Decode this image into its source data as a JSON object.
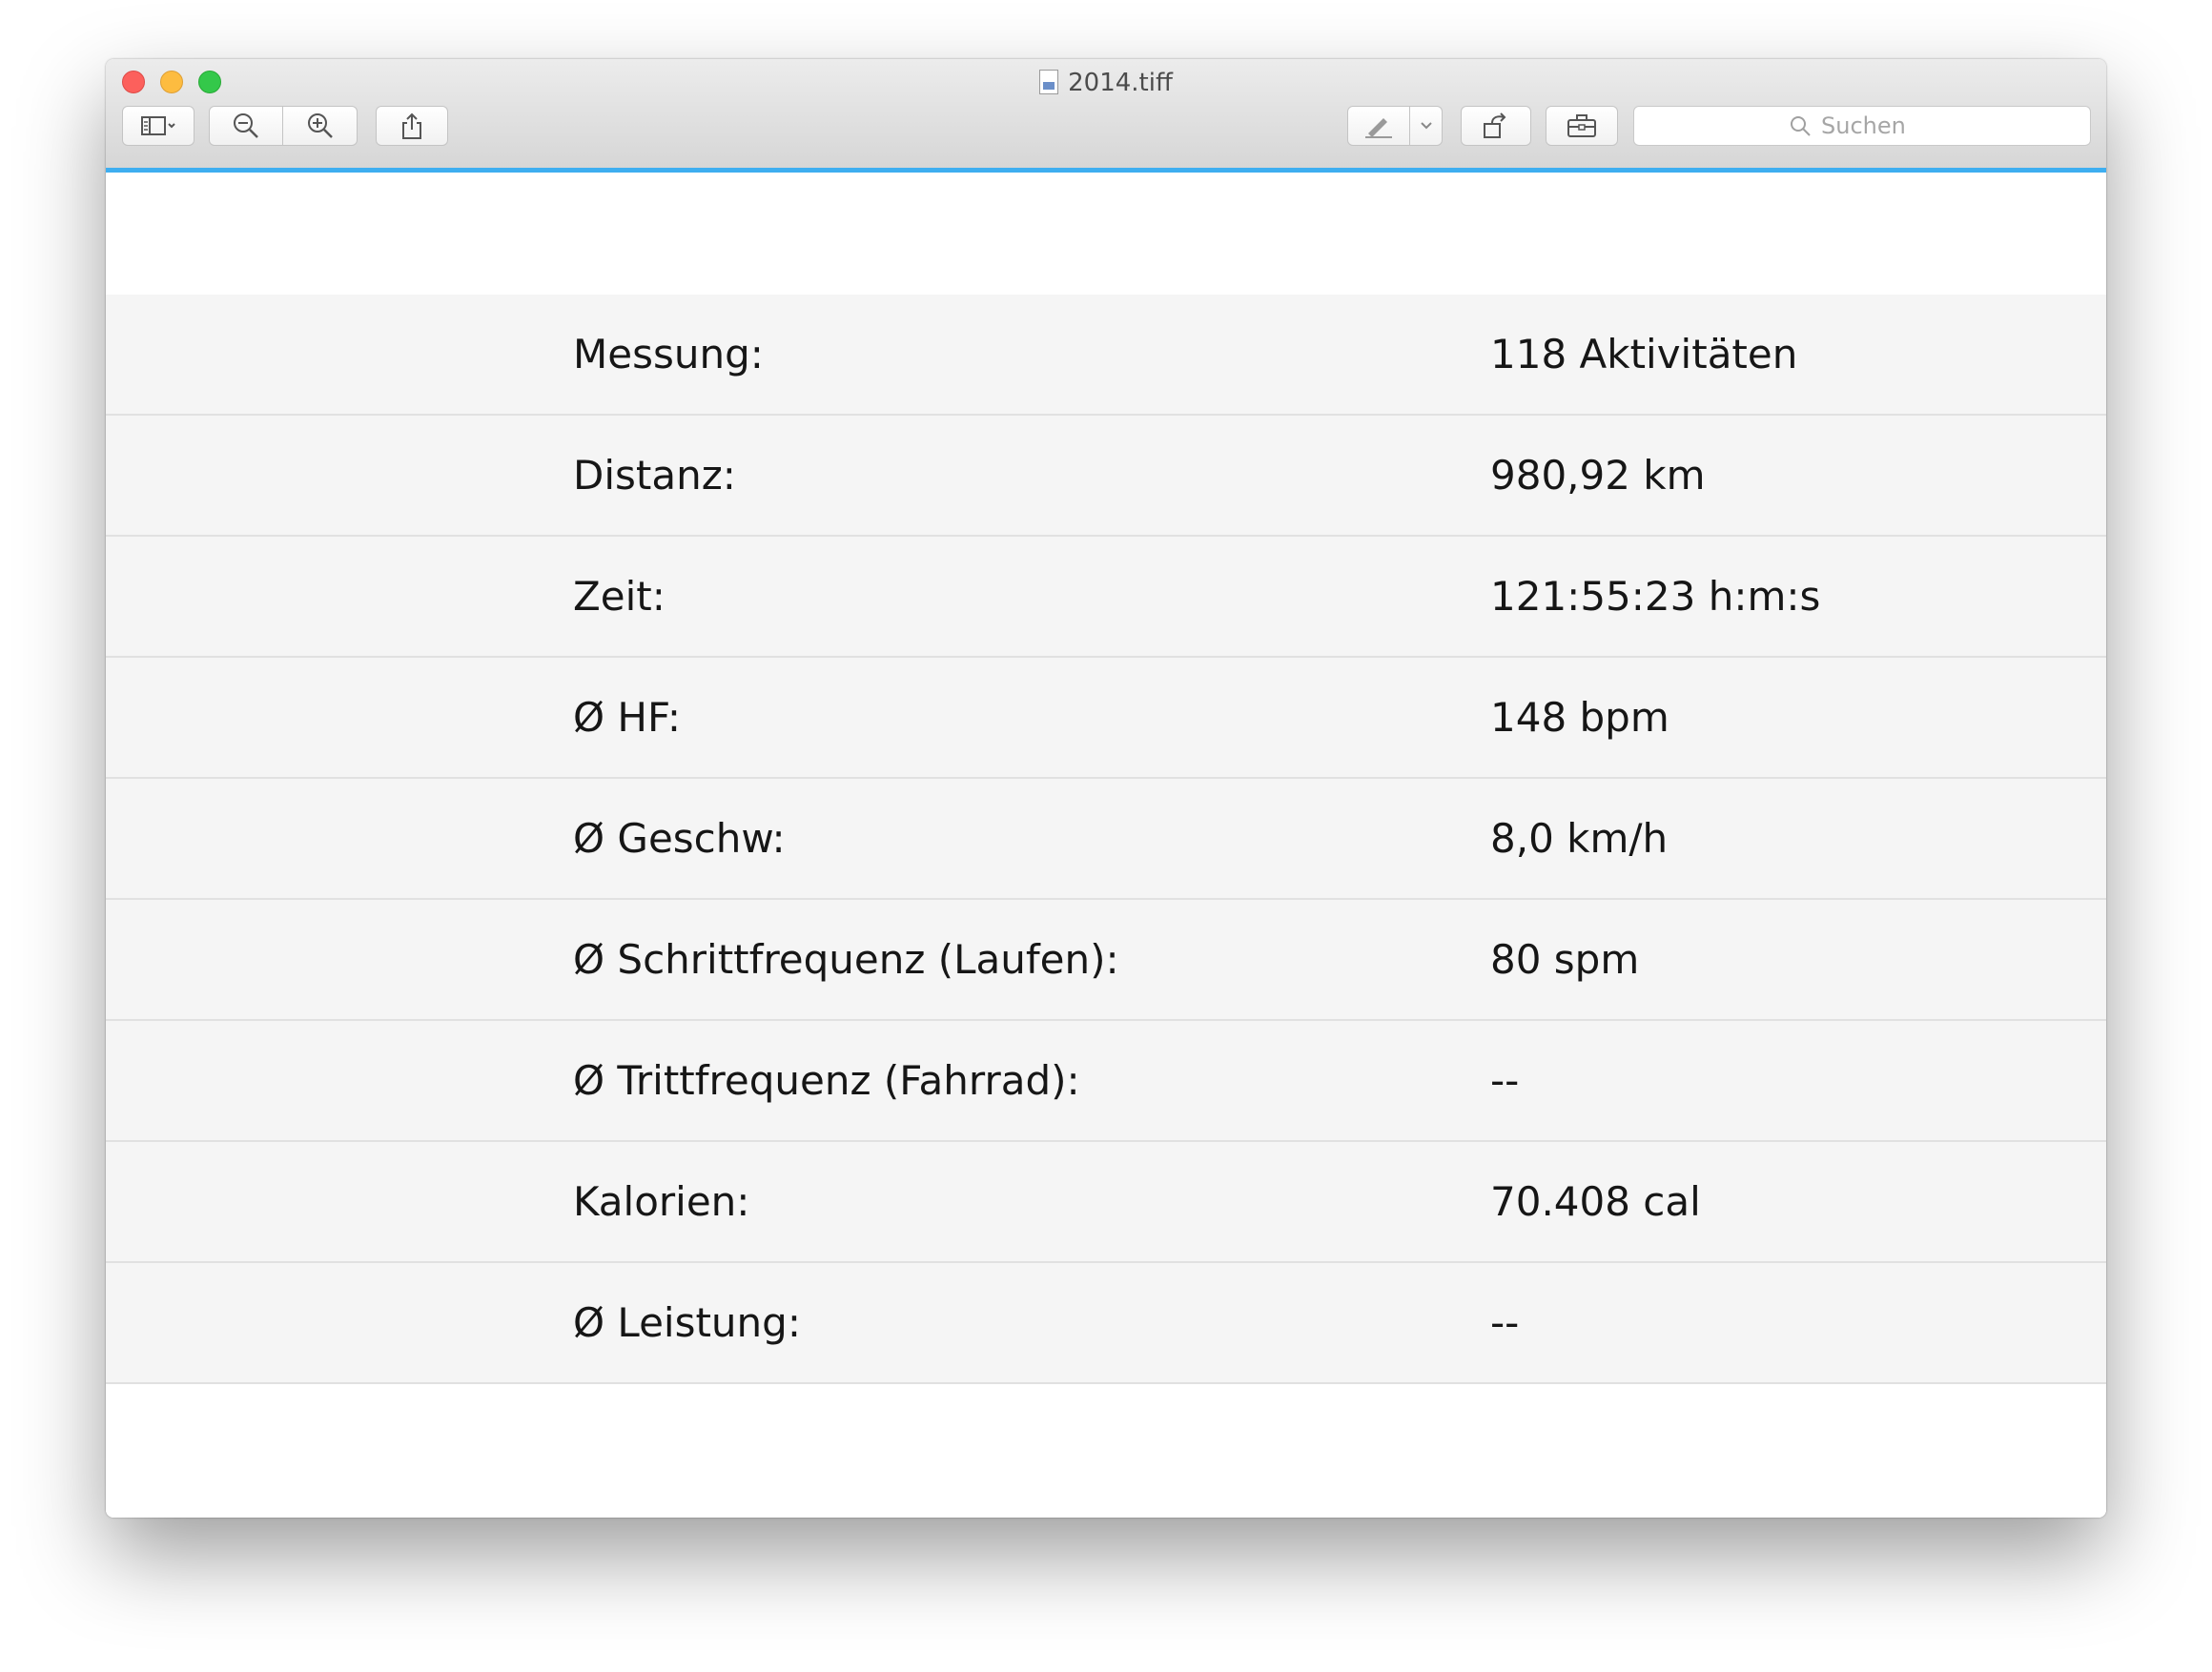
{
  "window": {
    "title": "2014.tiff"
  },
  "toolbar": {
    "buttons": [
      {
        "name": "sidebar-toggle",
        "icon": "sidebar-icon"
      },
      {
        "name": "zoom-out",
        "icon": "zoom-out-icon"
      },
      {
        "name": "zoom-in",
        "icon": "zoom-in-icon"
      },
      {
        "name": "share",
        "icon": "share-icon"
      },
      {
        "name": "markup",
        "icon": "pen-icon"
      },
      {
        "name": "rotate",
        "icon": "rotate-icon"
      },
      {
        "name": "toolbox",
        "icon": "toolbox-icon"
      }
    ],
    "search_placeholder": "Suchen",
    "accent_color": "#3eaef0"
  },
  "stats": {
    "rows": [
      {
        "label": "Messung:",
        "value": "118 Aktivitäten"
      },
      {
        "label": "Distanz:",
        "value": "980,92 km"
      },
      {
        "label": "Zeit:",
        "value": "121:55:23 h:m:s"
      },
      {
        "label": "Ø HF:",
        "value": "148 bpm"
      },
      {
        "label": "Ø Geschw:",
        "value": "8,0 km/h"
      },
      {
        "label": "Ø Schrittfrequenz (Laufen):",
        "value": "80 spm"
      },
      {
        "label": "Ø Trittfrequenz (Fahrrad):",
        "value": "--"
      },
      {
        "label": "Kalorien:",
        "value": "70.408 cal"
      },
      {
        "label": "Ø Leistung:",
        "value": "--"
      }
    ]
  }
}
